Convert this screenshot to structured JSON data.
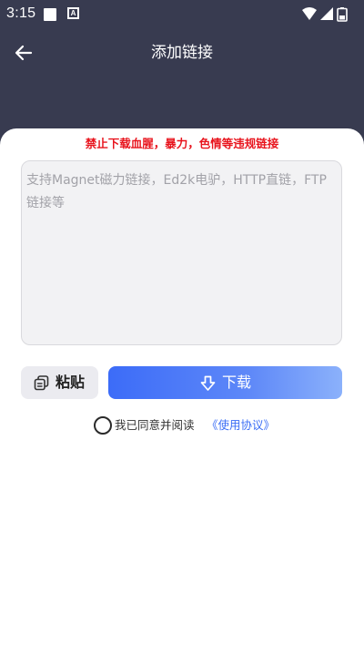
{
  "status_bar": {
    "time": "3:15",
    "notification_icons": [
      "app-notification-icon",
      "a-letter-icon"
    ],
    "system_icons": [
      "wifi-icon",
      "signal-icon",
      "battery-icon"
    ],
    "a_icon_letter": "A"
  },
  "header": {
    "title": "添加链接",
    "back_icon": "arrow-left-icon"
  },
  "warning": {
    "text": "禁止下载血腥，暴力，色情等违规链接"
  },
  "link_input": {
    "value": "",
    "placeholder": "支持Magnet磁力链接，Ed2k电驴，HTTP直链，FTP链接等"
  },
  "actions": {
    "paste_label": "粘贴",
    "paste_icon": "copy-icon",
    "download_label": "下载",
    "download_icon": "download-arrow-icon"
  },
  "agreement": {
    "text": "我已同意并阅读",
    "link_text": "《使用协议》",
    "checked": false
  },
  "colors": {
    "header_bg": "#383b50",
    "warning": "#e8141d",
    "accent": "#3c6cf8",
    "link": "#3b6ef5"
  }
}
